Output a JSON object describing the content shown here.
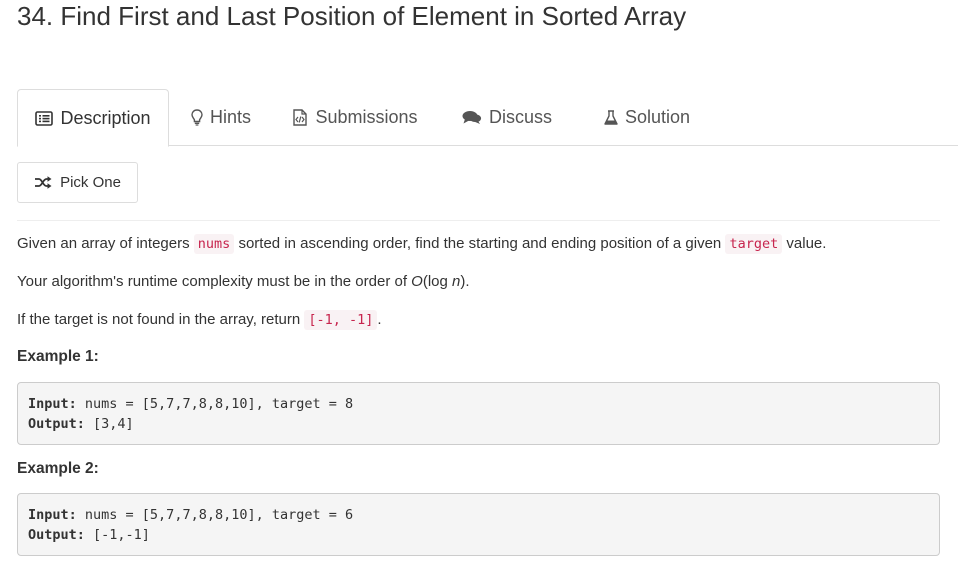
{
  "problem": {
    "title": "34. Find First and Last Position of Element in Sorted Array"
  },
  "tabs": [
    {
      "label": "Description",
      "icon": "list-alt-icon",
      "active": true
    },
    {
      "label": "Hints",
      "icon": "lightbulb-icon",
      "active": false
    },
    {
      "label": "Submissions",
      "icon": "code-file-icon",
      "active": false
    },
    {
      "label": "Discuss",
      "icon": "comments-icon",
      "active": false
    },
    {
      "label": "Solution",
      "icon": "flask-icon",
      "active": false
    }
  ],
  "pick_one": {
    "label": "Pick One",
    "icon": "random-shuffle-icon"
  },
  "description": {
    "p1": {
      "before": "Given an array of integers ",
      "code1": "nums",
      "middle": " sorted in ascending order, find the starting and ending position of a given ",
      "code2": "target",
      "after": " value."
    },
    "p2": {
      "before": "Your algorithm's runtime complexity must be in the order of ",
      "o": "O",
      "paren_open": "(log ",
      "n": "n",
      "paren_close": ")."
    },
    "p3": {
      "before": "If the target is not found in the array, return ",
      "code": "[-1, -1]",
      "after": "."
    }
  },
  "examples": [
    {
      "title": "Example 1:",
      "input_label": "Input:",
      "input_value": " nums = [5,7,7,8,8,10], target = 8",
      "output_label": "Output:",
      "output_value": " [3,4]"
    },
    {
      "title": "Example 2:",
      "input_label": "Input:",
      "input_value": " nums = [5,7,7,8,8,10], target = 6",
      "output_label": "Output:",
      "output_value": " [-1,-1]"
    }
  ],
  "colors": {
    "inline_code_text": "#c7254e",
    "inline_code_bg": "#f9f2f4",
    "pre_bg": "#f5f5f5",
    "border": "#dddddd"
  }
}
